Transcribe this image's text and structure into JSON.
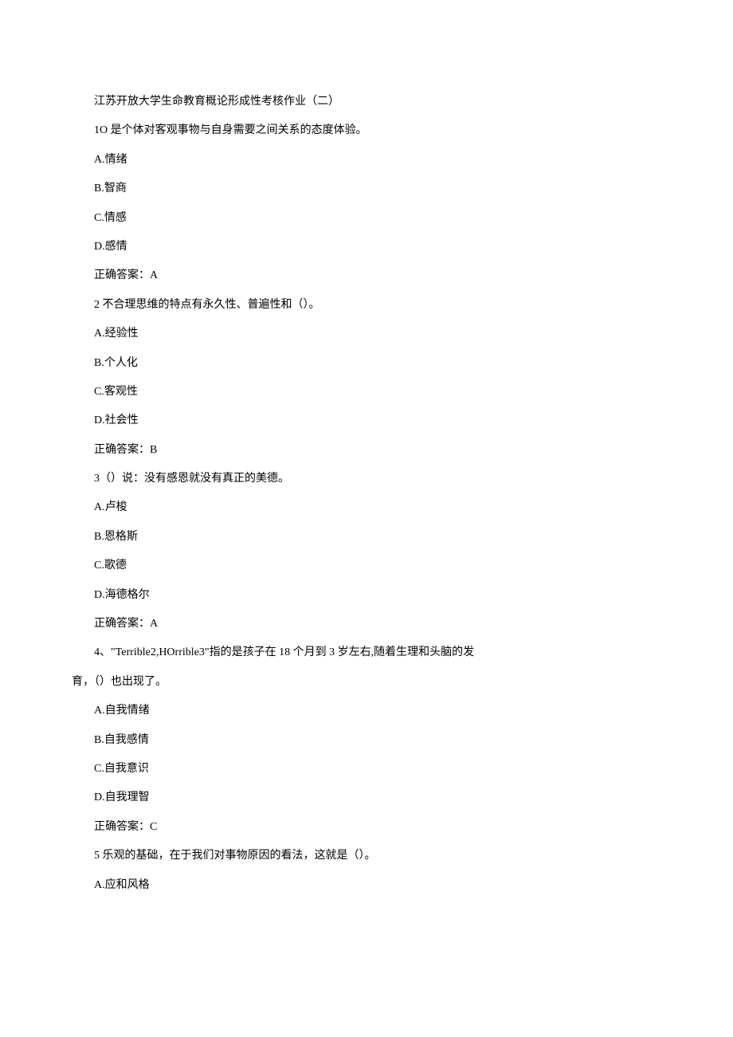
{
  "title": "江苏开放大学生命教育概论形成性考核作业（二）",
  "questions": [
    {
      "q": "1O 是个体对客观事物与自身需要之间关系的态度体验。",
      "options": [
        "A.情绪",
        "B.智商",
        "C.情感",
        "D.感情"
      ],
      "answer": "正确答案：A"
    },
    {
      "q": "2 不合理思维的特点有永久性、普遍性和（）。",
      "options": [
        "A.经验性",
        "B.个人化",
        "C.客观性",
        "D.社会性"
      ],
      "answer": "正确答案：B"
    },
    {
      "q": "3（）说：没有感恩就没有真正的美德。",
      "options": [
        "A.卢梭",
        "B.恩格斯",
        "C.歌德",
        "D.海德格尔"
      ],
      "answer": "正确答案：A"
    },
    {
      "q_part1": "4、\"Terrible2,HOrrible3\"指的是孩子在 18 个月到 3 岁左右,随着生理和头脑的发",
      "q_part2": "育，（）也出现了。",
      "options": [
        "A.自我情绪",
        "B.自我感情",
        "C.自我意识",
        "D.自我理智"
      ],
      "answer": "正确答案：C"
    },
    {
      "q": "5 乐观的基础，在于我们对事物原因的看法，这就是（）。",
      "options": [
        "A.应和风格"
      ]
    }
  ]
}
